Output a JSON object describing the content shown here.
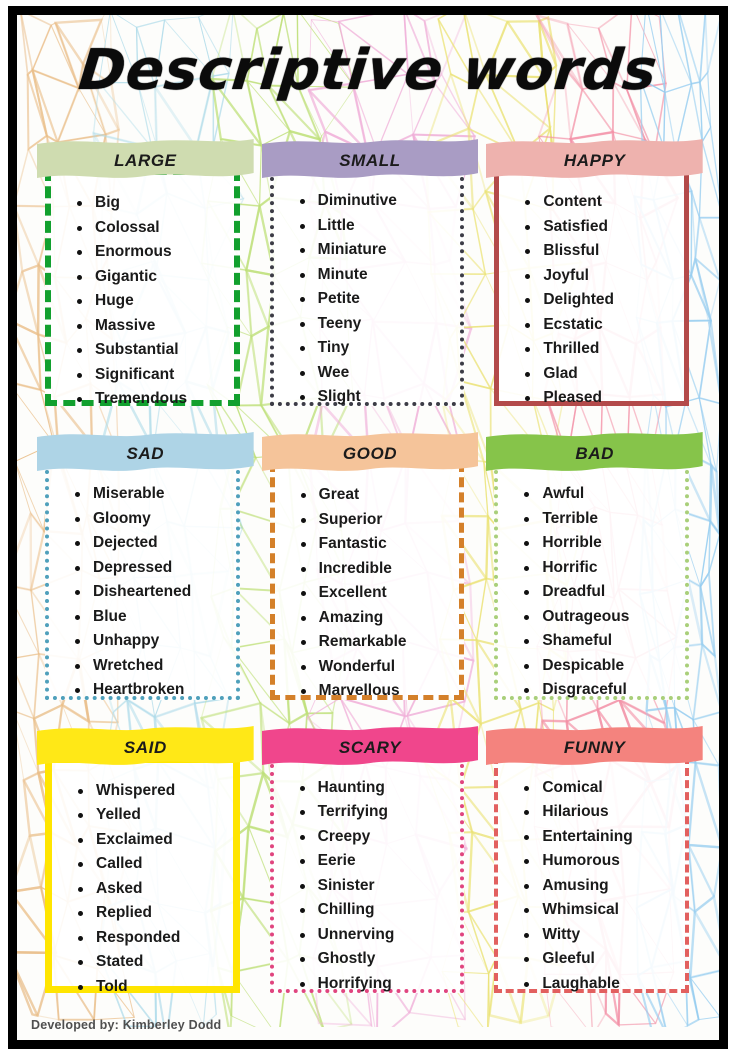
{
  "poster": {
    "title": "Descriptive words",
    "credit": "Developed by: Kimberley Dodd",
    "background_style": "pastel triangular mesh in vertical colour bands",
    "frame_color": "#000000",
    "page_color": "#fdfdfb"
  },
  "cards": [
    {
      "heading": "LARGE",
      "banner_color": "#cfdcb0",
      "border_color": "#12a02e",
      "border_style": "dashed",
      "words": [
        "Big",
        "Colossal",
        "Enormous",
        "Gigantic",
        "Huge",
        "Massive",
        "Substantial",
        "Significant",
        "Tremendous"
      ]
    },
    {
      "heading": "SMALL",
      "banner_color": "#a99cc4",
      "border_color": "#3c3c46",
      "border_style": "dotted",
      "words": [
        "Diminutive",
        "Little",
        "Miniature",
        "Minute",
        "Petite",
        "Teeny",
        "Tiny",
        "Wee",
        "Slight"
      ]
    },
    {
      "heading": "HAPPY",
      "banner_color": "#eeb2ae",
      "border_color": "#b34a4a",
      "border_style": "solid",
      "words": [
        "Content",
        "Satisfied",
        "Blissful",
        "Joyful",
        "Delighted",
        "Ecstatic",
        "Thrilled",
        "Glad",
        "Pleased"
      ]
    },
    {
      "heading": "SAD",
      "banner_color": "#aed4e6",
      "border_color": "#4fa0bb",
      "border_style": "dotted",
      "words": [
        "Miserable",
        "Gloomy",
        "Dejected",
        "Depressed",
        "Disheartened",
        "Blue",
        "Unhappy",
        "Wretched",
        "Heartbroken"
      ]
    },
    {
      "heading": "GOOD",
      "banner_color": "#f5c49a",
      "border_color": "#d4802a",
      "border_style": "dashed",
      "words": [
        "Great",
        "Superior",
        "Fantastic",
        "Incredible",
        "Excellent",
        "Amazing",
        "Remarkable",
        "Wonderful",
        "Marvellous"
      ]
    },
    {
      "heading": "BAD",
      "banner_color": "#86c44a",
      "border_color": "#a9cf7a",
      "border_style": "dotted",
      "words": [
        "Awful",
        "Terrible",
        "Horrible",
        "Horrific",
        "Dreadful",
        "Outrageous",
        "Shameful",
        "Despicable",
        "Disgraceful"
      ]
    },
    {
      "heading": "SAID",
      "banner_color": "#ffe817",
      "border_color": "#ffe500",
      "border_style": "solid",
      "words": [
        "Whispered",
        "Yelled",
        "Exclaimed",
        "Called",
        "Asked",
        "Replied",
        "Responded",
        "Stated",
        "Told"
      ]
    },
    {
      "heading": "SCARY",
      "banner_color": "#f0468c",
      "border_color": "#e0457f",
      "border_style": "dotted",
      "words": [
        "Haunting",
        "Terrifying",
        "Creepy",
        "Eerie",
        "Sinister",
        "Chilling",
        "Unnerving",
        "Ghostly",
        "Horrifying"
      ]
    },
    {
      "heading": "FUNNY",
      "banner_color": "#f4837e",
      "border_color": "#e2605f",
      "border_style": "dashed",
      "words": [
        "Comical",
        "Hilarious",
        "Entertaining",
        "Humorous",
        "Amusing",
        "Whimsical",
        "Witty",
        "Gleeful",
        "Laughable"
      ]
    }
  ]
}
